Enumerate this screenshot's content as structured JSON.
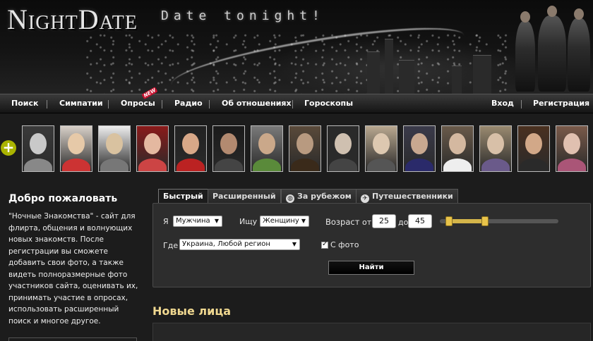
{
  "header": {
    "logo": "NightDate",
    "tagline": "Date tonight!"
  },
  "nav": {
    "items": [
      "Поиск",
      "Симпатии",
      "Опросы",
      "Радио",
      "Об отношениях",
      "Гороскопы"
    ],
    "new_badge": "NEW",
    "login": "Вход",
    "register": "Регистрация"
  },
  "photostrip": {
    "add_icon": "+",
    "count": 15
  },
  "welcome": {
    "title": "Добро пожаловать",
    "text": "\"Ночные Знакомства\" - сайт для флирта, общения и волнующих новых знакомств. После регистрации вы сможете добавить свои фото, а также видеть полноразмерные фото участников сайта, оценивать их, принимать участие в опросах, использовать расширенный поиск и многое другое."
  },
  "search": {
    "tabs": [
      "Быстрый",
      "Расширенный",
      "За рубежом",
      "Путешественники"
    ],
    "tab_icons": [
      "",
      "",
      "globe-icon",
      "plane-icon"
    ],
    "i_label": "Я",
    "i_value": "Мужчина",
    "seek_label": "Ищу",
    "seek_value": "Женщину",
    "age_label": "Возраст",
    "from_label": "от",
    "to_label": "до",
    "age_from": "25",
    "age_to": "45",
    "age_range_fraction": [
      0.08,
      0.38
    ],
    "where_label": "Где",
    "where_value": "Украина, Любой регион",
    "photo_label": "С фото",
    "find_label": "Найти"
  },
  "new_faces": {
    "title": "Новые лица"
  },
  "colors": {
    "accent": "#f0d890",
    "slider": "#e8c34a",
    "add_icon": "#a9b300"
  }
}
